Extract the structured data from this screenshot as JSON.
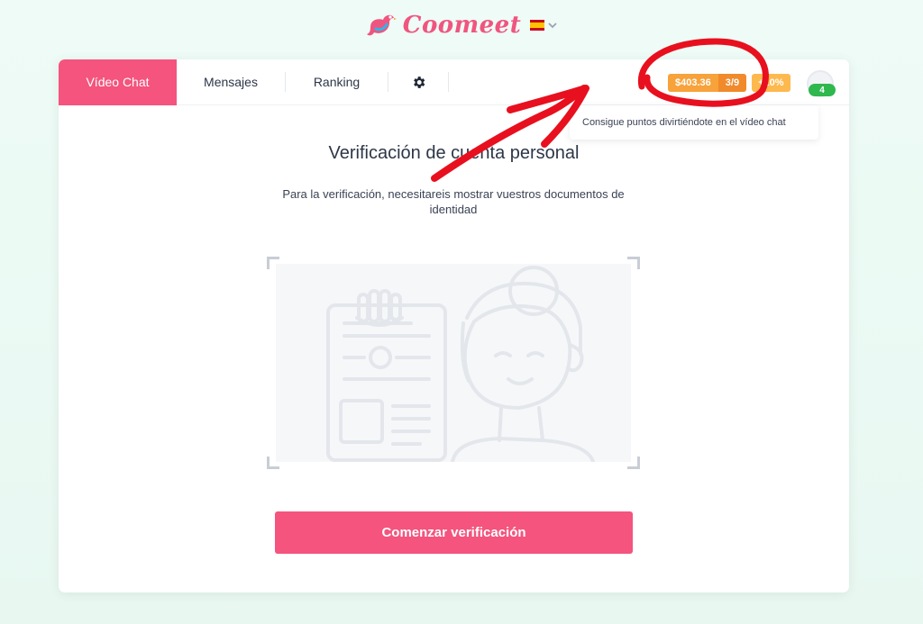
{
  "brand": {
    "name": "Coomeet",
    "logo_icon": "bird-logo-icon",
    "language_flag": "spain-flag-icon",
    "language_chevron": "chevron-down-icon"
  },
  "nav": {
    "tabs": [
      {
        "label": "Vídeo Chat",
        "active": true
      },
      {
        "label": "Mensajes",
        "active": false
      },
      {
        "label": "Ranking",
        "active": false
      }
    ],
    "settings_icon": "gear-icon"
  },
  "account": {
    "balance": "$403.36",
    "progress": "3/9",
    "bonus": "+10%",
    "level": "4",
    "avatar_icon": "user-avatar-icon"
  },
  "tooltip": {
    "text": "Consigue puntos divirtiéndote en el vídeo chat"
  },
  "verification": {
    "title": "Verificación de cuenta personal",
    "description": "Para la verificación, necesitareis mostrar vuestros documentos de identidad",
    "illustration_icon": "id-document-woman-illustration",
    "button_label": "Comenzar verificación"
  },
  "annotation": {
    "circle_icon": "red-circle-annotation",
    "arrow_icon": "red-arrow-annotation"
  },
  "colors": {
    "accent": "#f4547d",
    "brand_text": "#f0557f",
    "balance_pill": "#f7a23a",
    "progress_pill": "#f08a2b",
    "bonus_pill": "#fdb94e",
    "level_badge": "#2eb84e",
    "annotation": "#e8101e"
  }
}
